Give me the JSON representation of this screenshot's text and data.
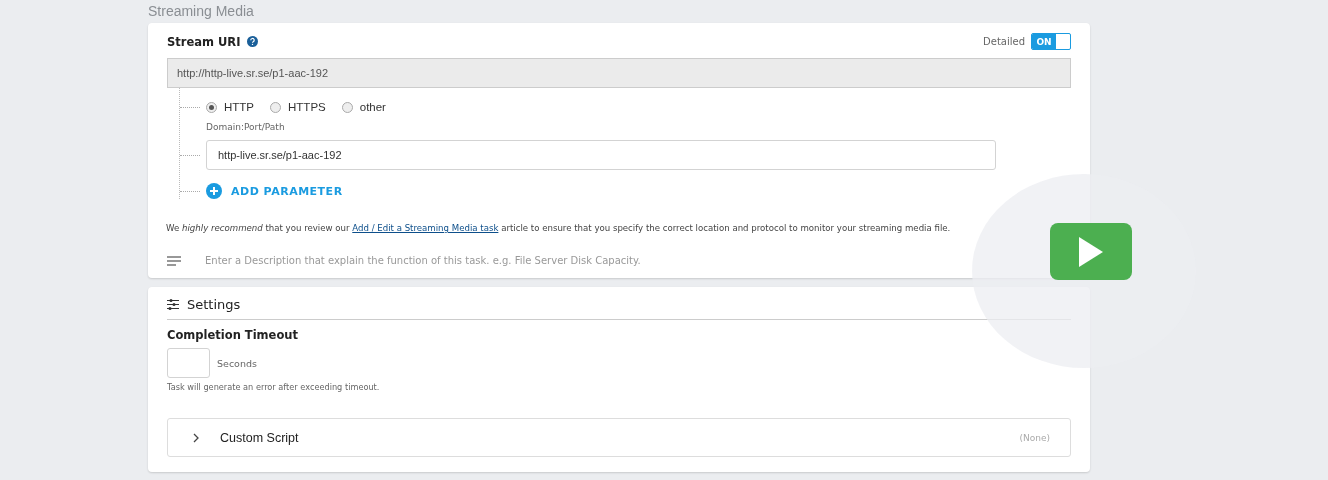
{
  "section_title": "Streaming Media",
  "stream_uri": {
    "label": "Stream URI",
    "detailed": {
      "label": "Detailed",
      "on": true,
      "state_text": "ON"
    },
    "full_uri": "http://http-live.sr.se/p1-aac-192",
    "protocols": [
      {
        "label": "HTTP",
        "selected": true
      },
      {
        "label": "HTTPS",
        "selected": false
      },
      {
        "label": "other",
        "selected": false
      }
    ],
    "path_label": "Domain:Port/Path",
    "path_value": "http-live.sr.se/p1-aac-192",
    "add_parameter": "ADD PARAMETER",
    "note": "We *highly recommend*  that you review our",
    "note_link": "Add / Edit a Streaming Media task",
    "note_end": "article to ensure that you specify the correct location and protocol to monitor your streaming media file.",
    "description_placeholder": "Enter a Description that explain the function of this task. e.g. File Server Disk Capacity."
  },
  "settings": {
    "title": "Settings",
    "timeout_label": "Completion Timeout",
    "timeout_unit": "Seconds",
    "timeout_hint": "Task will generate an error after exceeding timeout.",
    "custom_script": {
      "label": "Custom Script",
      "value": "(None)",
      "expanded": false
    }
  }
}
